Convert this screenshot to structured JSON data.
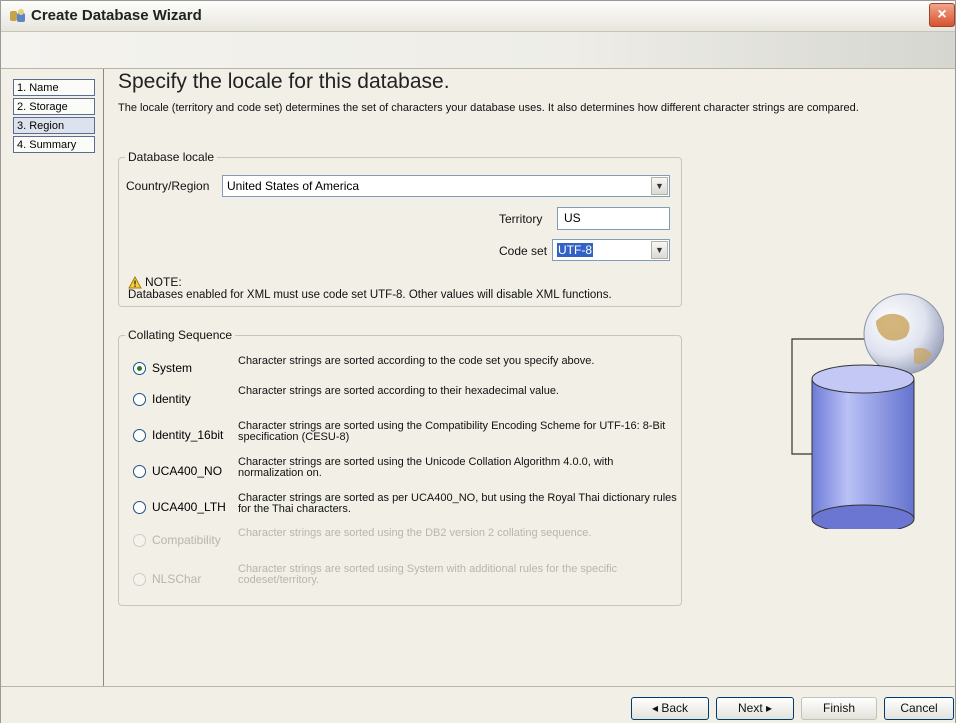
{
  "window": {
    "title": "Create Database Wizard",
    "close_icon": "×"
  },
  "nav": {
    "items": [
      {
        "label": "1. Name",
        "active": false
      },
      {
        "label": "2. Storage",
        "active": false
      },
      {
        "label": "3. Region",
        "active": true
      },
      {
        "label": "4. Summary",
        "active": false
      }
    ]
  },
  "page": {
    "heading": "Specify the locale for this database.",
    "description": "The locale (territory and code set) determines the set of characters your database uses. It also determines how different character strings are compared."
  },
  "locale": {
    "group_title": "Database locale",
    "country_label": "Country/Region",
    "country_value": "United States of America",
    "territory_label": "Territory",
    "territory_value": "US",
    "codeset_label": "Code set",
    "codeset_value": "UTF-8",
    "note_title": "NOTE:",
    "note_text": "Databases enabled for XML must use code set UTF-8. Other values will disable XML functions."
  },
  "collating": {
    "group_title": "Collating Sequence",
    "options": [
      {
        "label": "System",
        "desc": "Character strings are sorted according to the code set you specify above.",
        "checked": true,
        "enabled": true
      },
      {
        "label": "Identity",
        "desc": "Character strings are sorted according to their hexadecimal value.",
        "checked": false,
        "enabled": true
      },
      {
        "label": "Identity_16bit",
        "desc": "Character strings are sorted using the Compatibility Encoding Scheme for UTF-16: 8-Bit specification (CESU-8)",
        "checked": false,
        "enabled": true
      },
      {
        "label": "UCA400_NO",
        "desc": "Character strings are sorted using the Unicode Collation Algorithm 4.0.0, with normalization on.",
        "checked": false,
        "enabled": true
      },
      {
        "label": "UCA400_LTH",
        "desc": "Character strings are sorted as per UCA400_NO, but using the Royal Thai dictionary rules for the Thai characters.",
        "checked": false,
        "enabled": true
      },
      {
        "label": "Compatibility",
        "desc": "Character strings are sorted using the DB2 version 2 collating sequence.",
        "checked": false,
        "enabled": false
      },
      {
        "label": "NLSChar",
        "desc": "Character strings are sorted using System with additional rules for the specific codeset/territory.",
        "checked": false,
        "enabled": false
      }
    ]
  },
  "footer": {
    "back_label": "◂ Back",
    "next_label": "Next ▸",
    "finish_label": "Finish",
    "cancel_label": "Cancel"
  },
  "colors": {
    "accent": "#3162c4",
    "cylinder": "#8c97e6",
    "globe": "#dfe3ef"
  }
}
